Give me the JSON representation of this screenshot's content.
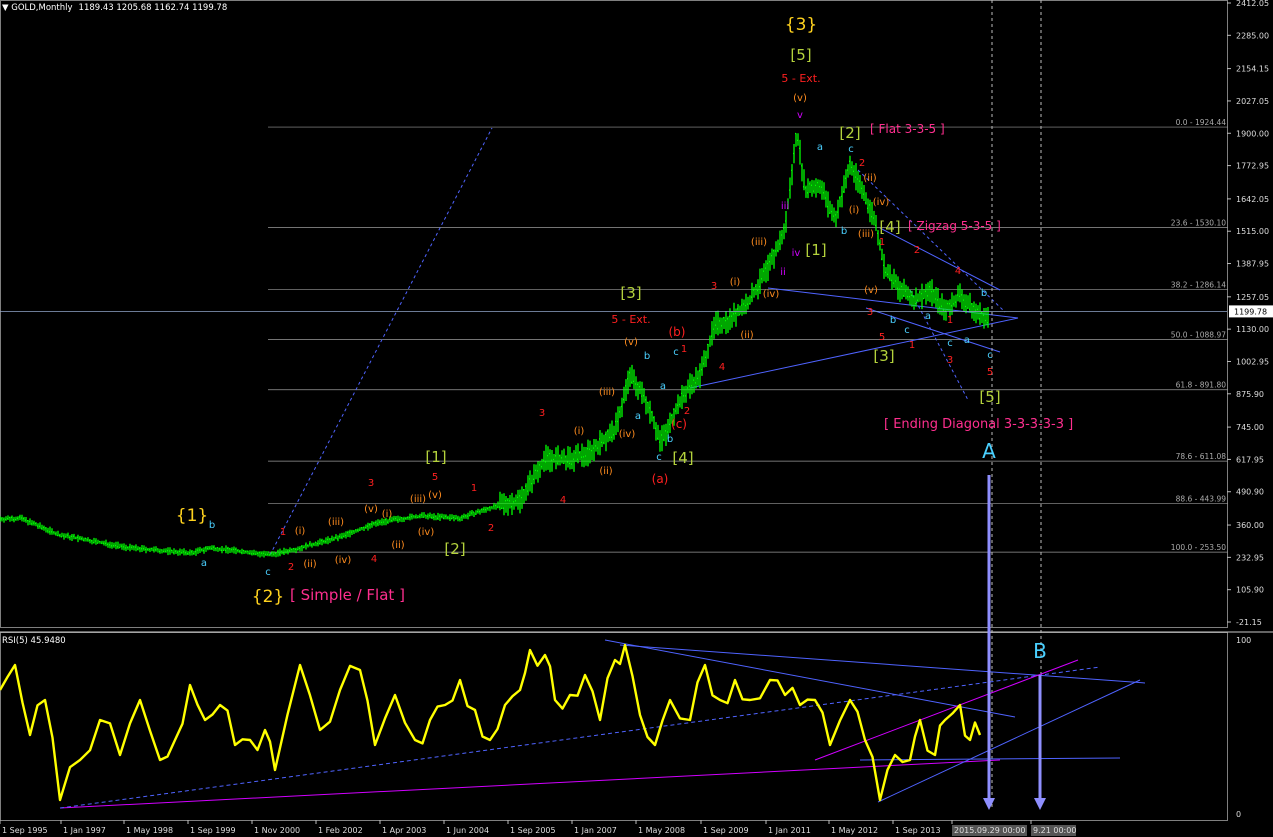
{
  "header": {
    "symbol": "GOLD,Monthly",
    "ohlc": "1189.43 1205.68 1162.74 1199.78"
  },
  "rsi_header": "RSI(5) 45.9480",
  "current_price": "1199.78",
  "price_axis": [
    "2412.05",
    "2285.00",
    "2154.15",
    "2027.05",
    "1900.00",
    "1772.95",
    "1642.05",
    "1515.00",
    "1387.95",
    "1257.05",
    "1130.00",
    "1002.95",
    "875.90",
    "745.00",
    "617.95",
    "490.90",
    "360.00",
    "232.95",
    "105.90",
    "-21.15"
  ],
  "rsi_axis": [
    "100",
    "0"
  ],
  "time_axis": [
    "1 Sep 1995",
    "1 Jan 1997",
    "1 May 1998",
    "1 Sep 1999",
    "1 Nov 2000",
    "1 Feb 2002",
    "1 Apr 2003",
    "1 Jun 2004",
    "1 Sep 2005",
    "1 Jan 2007",
    "1 May 2008",
    "1 Sep 2009",
    "1 Jan 2011",
    "1 May 2012",
    "1 Sep 2013",
    "2015.09.29 00:00",
    "9.21 00:00"
  ],
  "fib_levels": [
    "0.0 - 1924.44",
    "23.6 - 1530.10",
    "38.2 - 1286.14",
    "50.0 - 1088.97",
    "61.8 - 891.80",
    "78.6 - 611.08",
    "88.6 - 443.99",
    "100.0 - 253.50"
  ],
  "labels": {
    "w1": "{1}",
    "w2": "{2}",
    "w3": "{3}",
    "simple_flat": "[ Simple / Flat ]",
    "flat_335": "[ Flat 3-3-5 ]",
    "zigzag": "[ Zigzag 5-3-5 ]",
    "ending_diag": "[ Ending Diagonal 3-3-3-3-3 ]",
    "ext": "5 - Ext.",
    "s1": "[1]",
    "s2": "[2]",
    "s3": "[3]",
    "s4": "[4]",
    "s5": "[5]",
    "pa": "(a)",
    "pb": "(b)",
    "pc": "(c)",
    "ri": "(i)",
    "rii": "(ii)",
    "riii": "(iii)",
    "riv": "(iv)",
    "rv": "(v)",
    "n1": "1",
    "n2": "2",
    "n3": "3",
    "n4": "4",
    "n5": "5",
    "la": "a",
    "lb": "b",
    "lc": "c",
    "ri2": "i",
    "rii2": "ii",
    "riii2": "iii",
    "riv2": "iv",
    "rv2": "v",
    "A": "A",
    "B": "B"
  },
  "colors": {
    "price": "#00ff00",
    "rsi": "#ffff00",
    "trend": "#4f63ff",
    "magenta": "#d100ff",
    "pink": "#ff2f8f",
    "fib": "#9a9a9a",
    "cyan": "#4ad0ff",
    "olive": "#b4d23c",
    "gold": "#ffd21e",
    "red": "#ff2020",
    "orange": "#ff8c1e"
  },
  "chart_data": {
    "type": "line",
    "title": "GOLD,Monthly",
    "series": [
      {
        "name": "GOLD,Monthly",
        "x": [
          "1995-09",
          "1997-01",
          "1998-05",
          "1999-09",
          "2000-11",
          "2002-02",
          "2003-04",
          "2004-06",
          "2005-09",
          "2007-01",
          "2008-05",
          "2008-11",
          "2009-09",
          "2011-01",
          "2011-09",
          "2012-05",
          "2013-06",
          "2013-12",
          "2014-06",
          "2014-11",
          "2015-02",
          "2015-09"
        ],
        "values": [
          385,
          350,
          300,
          280,
          265,
          300,
          340,
          395,
          470,
          640,
          930,
          730,
          1010,
          1350,
          1920,
          1550,
          1200,
          1250,
          1320,
          1150,
          1300,
          1200
        ]
      },
      {
        "name": "RSI(5)",
        "x": [
          "1995-09",
          "1997-01",
          "1998-05",
          "1999-09",
          "2000-11",
          "2002-02",
          "2003-04",
          "2004-06",
          "2005-09",
          "2007-01",
          "2008-05",
          "2009-09",
          "2011-01",
          "2012-05",
          "2013-09",
          "2015-09"
        ],
        "values": [
          65,
          8,
          40,
          55,
          22,
          75,
          60,
          45,
          85,
          70,
          30,
          55,
          60,
          35,
          5,
          46
        ]
      }
    ],
    "ylim": [
      -21.15,
      2412.05
    ],
    "rsi_ylim": [
      0,
      100
    ],
    "grid": false,
    "fib_levels": [
      1924.44,
      1530.1,
      1286.14,
      1088.97,
      891.8,
      611.08,
      443.99,
      253.5
    ]
  }
}
